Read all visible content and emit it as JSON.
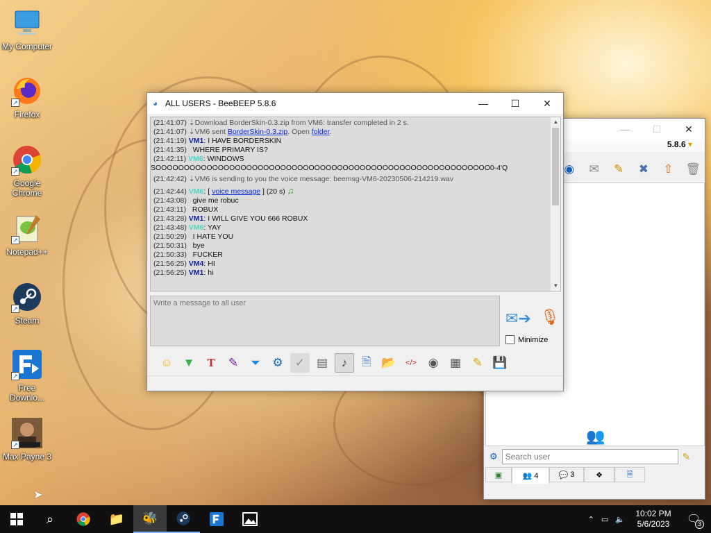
{
  "desktop": {
    "icons": [
      {
        "label": "My Computer"
      },
      {
        "label": "Firefox"
      },
      {
        "label": "Google Chrome"
      },
      {
        "label": "Notepad++"
      },
      {
        "label": "Steam"
      },
      {
        "label": "Free Downlo..."
      },
      {
        "label": "Max Payne 3"
      }
    ]
  },
  "chat_window": {
    "title": "ALL USERS - BeeBEEP 5.8.6",
    "messages": [
      {
        "time": "(21:41:07)",
        "text": "Download BorderSkin-0.3.zip from VM6: transfer completed in 2 s."
      },
      {
        "time": "(21:41:07)",
        "pre": "VM6 sent ",
        "link1": "BorderSkin-0.3.zip",
        "mid": ". Open ",
        "link2": "folder",
        "post": "."
      },
      {
        "time": "(21:41:19)",
        "user": "VM1",
        "text": "I HAVE BORDERSKIN"
      },
      {
        "time": "(21:41:35)",
        "text": "WHERE PRIMARY IS?"
      },
      {
        "time": "(21:42:11)",
        "user": "VM6",
        "text": "WINDOWS"
      },
      {
        "text": "SOOOOOOOOOOOOOOOOOOOOOOOOOOOOOOOOOOOOOOOOOOOOOOOOOOOOOOOOOOO0-4'Q"
      },
      {
        "time": "(21:42:42)",
        "text": "VM6 is sending to you the voice message: beemsg-VM6-20230506-214219.wav"
      },
      {
        "time": "(21:42:44)",
        "user": "VM6",
        "pre": "[ ",
        "link1": "voice message",
        "post": " ] (20 s)"
      },
      {
        "time": "(21:43:08)",
        "text": "give me robuc"
      },
      {
        "time": "(21:43:11)",
        "text": "ROBUX"
      },
      {
        "time": "(21:43:28)",
        "user": "VM1",
        "text": "I WILL GIVE YOU 666 ROBUX"
      },
      {
        "time": "(21:43:48)",
        "user": "VM6",
        "text": "YAY"
      },
      {
        "time": "(21:50:29)",
        "text": "I HATE YOU"
      },
      {
        "time": "(21:50:31)",
        "text": "bye"
      },
      {
        "time": "(21:50:33)",
        "text": "FUCKER"
      },
      {
        "time": "(21:56:25)",
        "user": "VM4",
        "text": "HI"
      },
      {
        "time": "(21:56:25)",
        "user": "VM1",
        "text": "hi"
      }
    ],
    "input_placeholder": "Write a message to all user",
    "minimize_label": "Minimize"
  },
  "user_window": {
    "version": "5.8.6",
    "search_placeholder": "Search user",
    "tabs": [
      {
        "icon": "users-icon",
        "count": "4"
      },
      {
        "icon": "chat-icon",
        "count": "3"
      }
    ]
  },
  "taskbar": {
    "time": "10:02 PM",
    "date": "5/6/2023",
    "notification_count": "3"
  },
  "colors": {
    "user_vm1": "#0c1d9c",
    "user_vm6": "#4fd6c3",
    "link": "#0b2bd6"
  }
}
